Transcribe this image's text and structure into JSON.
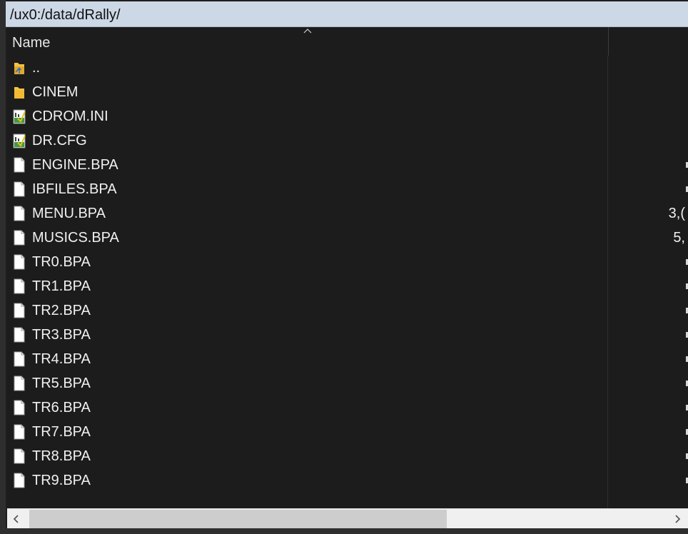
{
  "path": "/ux0:/data/dRally/",
  "columns": {
    "name": "Name"
  },
  "files": [
    {
      "name": "..",
      "type": "parent",
      "icon": "parent-folder-icon",
      "size": ""
    },
    {
      "name": "CINEM",
      "type": "folder",
      "icon": "folder-icon",
      "size": ""
    },
    {
      "name": "CDROM.INI",
      "type": "config",
      "icon": "config-file-icon",
      "size": ""
    },
    {
      "name": "DR.CFG",
      "type": "config",
      "icon": "config-file-icon",
      "size": ""
    },
    {
      "name": "ENGINE.BPA",
      "type": "file",
      "icon": "file-icon",
      "size": ""
    },
    {
      "name": "IBFILES.BPA",
      "type": "file",
      "icon": "file-icon",
      "size": ""
    },
    {
      "name": "MENU.BPA",
      "type": "file",
      "icon": "file-icon",
      "size": "3,("
    },
    {
      "name": "MUSICS.BPA",
      "type": "file",
      "icon": "file-icon",
      "size": "5,"
    },
    {
      "name": "TR0.BPA",
      "type": "file",
      "icon": "file-icon",
      "size": ""
    },
    {
      "name": "TR1.BPA",
      "type": "file",
      "icon": "file-icon",
      "size": ""
    },
    {
      "name": "TR2.BPA",
      "type": "file",
      "icon": "file-icon",
      "size": ""
    },
    {
      "name": "TR3.BPA",
      "type": "file",
      "icon": "file-icon",
      "size": ""
    },
    {
      "name": "TR4.BPA",
      "type": "file",
      "icon": "file-icon",
      "size": ""
    },
    {
      "name": "TR5.BPA",
      "type": "file",
      "icon": "file-icon",
      "size": ""
    },
    {
      "name": "TR6.BPA",
      "type": "file",
      "icon": "file-icon",
      "size": ""
    },
    {
      "name": "TR7.BPA",
      "type": "file",
      "icon": "file-icon",
      "size": ""
    },
    {
      "name": "TR8.BPA",
      "type": "file",
      "icon": "file-icon",
      "size": ""
    },
    {
      "name": "TR9.BPA",
      "type": "file",
      "icon": "file-icon",
      "size": ""
    }
  ],
  "scrollbar": {
    "horizontal_position": 0.0,
    "left_icon": "chevron-left-icon",
    "right_icon": "chevron-right-icon"
  },
  "colors": {
    "path_bar": "#ccd8e6",
    "list_background": "#1c1c1c",
    "text": "#f0f0f0",
    "folder": "#f4c542"
  }
}
